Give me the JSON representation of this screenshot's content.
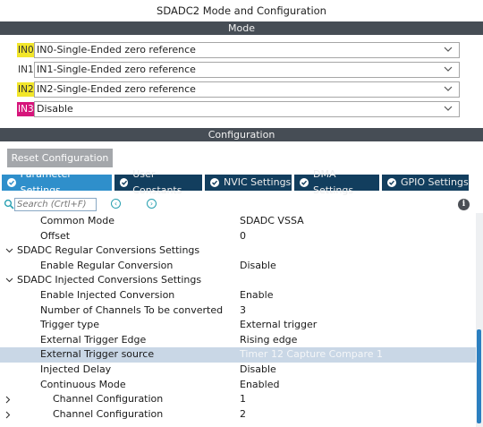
{
  "window": {
    "title": "SDADC2 Mode and Configuration"
  },
  "mode": {
    "header": "Mode",
    "rows": [
      {
        "label": "IN0",
        "value": "IN0-Single-Ended zero reference",
        "highlight": "yellow"
      },
      {
        "label": "IN1",
        "value": "IN1-Single-Ended zero reference",
        "highlight": "none"
      },
      {
        "label": "IN2",
        "value": "IN2-Single-Ended zero reference",
        "highlight": "yellow"
      },
      {
        "label": "IN3",
        "value": "Disable",
        "highlight": "magenta"
      }
    ]
  },
  "configuration": {
    "header": "Configuration",
    "reset_label": "Reset Configuration",
    "tabs": [
      {
        "label": "Parameter Settings",
        "active": true
      },
      {
        "label": "User Constants",
        "active": false
      },
      {
        "label": "NVIC Settings",
        "active": false
      },
      {
        "label": "DMA Settings",
        "active": false
      },
      {
        "label": "GPIO Settings",
        "active": false
      }
    ],
    "search": {
      "placeholder": "Search (Crtl+F)"
    },
    "params": [
      {
        "name": "Common Mode",
        "value": "SDADC VSSA"
      },
      {
        "name": "Offset",
        "value": "0"
      },
      {
        "name": "SDADC Regular Conversions Settings",
        "value": ""
      },
      {
        "name": "Enable Regular Conversion",
        "value": "Disable"
      },
      {
        "name": "SDADC Injected Conversions Settings",
        "value": ""
      },
      {
        "name": "Enable Injected Conversion",
        "value": "Enable"
      },
      {
        "name": "Number of Channels To be converted",
        "value": "3"
      },
      {
        "name": "Trigger type",
        "value": "External trigger"
      },
      {
        "name": "External Trigger Edge",
        "value": "Rising edge"
      },
      {
        "name": "External Trigger source",
        "value": "Timer 12 Capture Compare 1"
      },
      {
        "name": "Injected Delay",
        "value": "Disable"
      },
      {
        "name": "Continuous Mode",
        "value": "Enabled"
      },
      {
        "name": "Channel Configuration",
        "value": "1"
      },
      {
        "name": "Channel Configuration",
        "value": "2"
      }
    ]
  },
  "colors": {
    "section_bar": "#464d55",
    "tab_active": "#2f8fcb",
    "tab_inactive": "#123e5e",
    "highlight_yellow": "#f2e62a",
    "highlight_magenta": "#d6157b",
    "selected_row": "#c9d7e6",
    "scroll_thumb": "#2b7fc0"
  },
  "icons": {
    "dropdown": "chevron-down-icon",
    "tab_check": "check-circle-icon",
    "search": "search-icon",
    "prev": "prev-result-icon",
    "next": "next-result-icon",
    "info": "info-icon",
    "expanded": "caret-expanded-icon",
    "collapsed": "caret-collapsed-icon"
  }
}
